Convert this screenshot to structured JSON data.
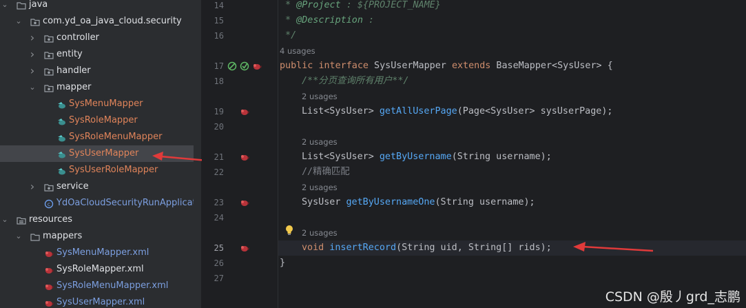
{
  "tree": {
    "items": [
      {
        "label": "java",
        "chevron": "down",
        "icon": "folder-icon",
        "color": "normal"
      },
      {
        "label": "com.yd_oa_java_cloud.security",
        "chevron": "down",
        "icon": "package-icon",
        "color": "normal"
      },
      {
        "label": "controller",
        "chevron": "right",
        "icon": "package-icon",
        "color": "normal"
      },
      {
        "label": "entity",
        "chevron": "right",
        "icon": "package-icon",
        "color": "normal"
      },
      {
        "label": "handler",
        "chevron": "right",
        "icon": "package-icon",
        "color": "normal"
      },
      {
        "label": "mapper",
        "chevron": "down",
        "icon": "package-icon",
        "color": "normal"
      },
      {
        "label": "SysMenuMapper",
        "chevron": "",
        "icon": "mapper-interface-icon",
        "color": "orange"
      },
      {
        "label": "SysRoleMapper",
        "chevron": "",
        "icon": "mapper-interface-icon",
        "color": "orange"
      },
      {
        "label": "SysRoleMenuMapper",
        "chevron": "",
        "icon": "mapper-interface-icon",
        "color": "orange"
      },
      {
        "label": "SysUserMapper",
        "chevron": "",
        "icon": "mapper-interface-icon",
        "color": "orange",
        "selected": true
      },
      {
        "label": "SysUserRoleMapper",
        "chevron": "",
        "icon": "mapper-interface-icon",
        "color": "orange"
      },
      {
        "label": "service",
        "chevron": "right",
        "icon": "package-icon",
        "color": "normal"
      },
      {
        "label": "YdOaCloudSecurityRunApplication",
        "chevron": "",
        "icon": "spring-boot-class-icon",
        "color": "blue"
      },
      {
        "label": "resources",
        "chevron": "down",
        "icon": "resources-folder-icon",
        "color": "normal"
      },
      {
        "label": "mappers",
        "chevron": "down",
        "icon": "folder-icon",
        "color": "normal"
      },
      {
        "label": "SysMenuMapper.xml",
        "chevron": "",
        "icon": "mybatis-xml-icon",
        "color": "blue"
      },
      {
        "label": "SysRoleMapper.xml",
        "chevron": "",
        "icon": "mybatis-xml-icon",
        "color": "normal"
      },
      {
        "label": "SysRoleMenuMapper.xml",
        "chevron": "",
        "icon": "mybatis-xml-icon",
        "color": "blue"
      },
      {
        "label": "SysUserMapper.xml",
        "chevron": "",
        "icon": "mybatis-xml-icon",
        "color": "blue"
      }
    ]
  },
  "editor": {
    "line_numbers": [
      "14",
      "15",
      "16",
      "17",
      "18",
      "19",
      "20",
      "21",
      "22",
      "23",
      "24",
      "25",
      "26",
      "27"
    ],
    "doc_project_prefix": " * ",
    "doc_project_tag": "@Project",
    "doc_project_rest": " : ${PROJECT_NAME}",
    "doc_desc_prefix": " * ",
    "doc_desc_tag": "@Description",
    "doc_desc_rest": " :",
    "doc_end": " */",
    "usage_4": "4 usages",
    "decl_kw1": "public",
    "decl_kw2": "interface",
    "decl_name": " SysUserMapper ",
    "decl_kw3": "extends",
    "decl_rest": " BaseMapper<SysUser> {",
    "javadoc_comment": "/**分页查询所有用户**/",
    "usage_2a": "2 usages",
    "m1_type": "List<SysUser> ",
    "m1_name": "getAllUserPage",
    "m1_params": "(Page<SysUser> sysUserPage);",
    "usage_2b": "2 usages",
    "m2_type": "List<SysUser> ",
    "m2_name": "getByUsername",
    "m2_params": "(String username);",
    "line_comment": "//精确匹配",
    "usage_2c": "2 usages",
    "m3_type": "SysUser ",
    "m3_name": "getByUsernameOne",
    "m3_params": "(String username);",
    "usage_2d": "2 usages",
    "m4_kw": "void",
    "m4_name": " insertRecord",
    "m4_params": "(String uid, String[] rids);",
    "close_brace": "}"
  },
  "watermark": "CSDN @殷丿grd_志鹏",
  "colors": {
    "orange_label": "#e0845a",
    "blue_label": "#7c9fe0",
    "keyword": "#cf8e6d",
    "function": "#56a8f5",
    "arrow": "#e03a3a"
  }
}
